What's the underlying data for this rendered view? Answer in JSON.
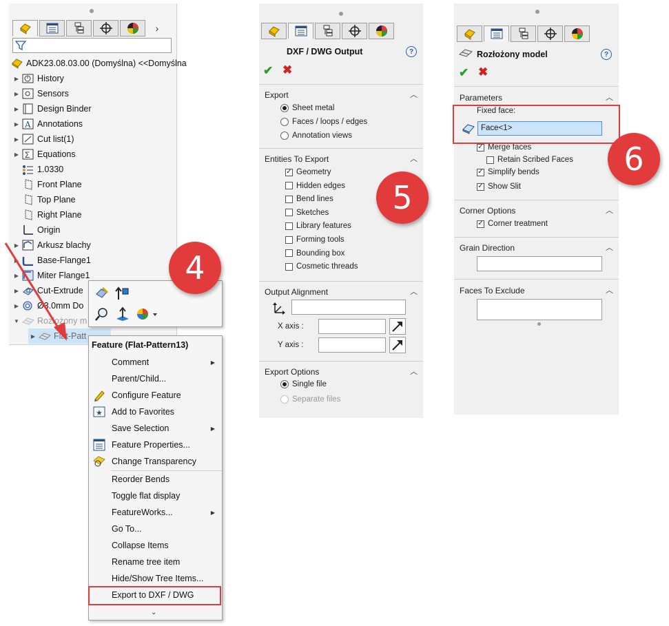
{
  "colors": {
    "accent_red": "#e23b3b",
    "ok_green": "#2c9a2c",
    "cancel_red": "#d42020",
    "selection_blue": "#cce4f7"
  },
  "tree": {
    "root": "ADK23.08.03.00 (Domyślna) <<Domyślna",
    "items": [
      {
        "label": "History",
        "icon": "history-icon"
      },
      {
        "label": "Sensors",
        "icon": "sensors-icon"
      },
      {
        "label": "Design Binder",
        "icon": "design-binder-icon"
      },
      {
        "label": "Annotations",
        "icon": "annotations-icon"
      },
      {
        "label": "Cut list(1)",
        "icon": "cut-list-icon"
      },
      {
        "label": "Equations",
        "icon": "equations-icon"
      },
      {
        "label": "1.0330",
        "icon": "material-icon"
      },
      {
        "label": "Front Plane",
        "icon": "plane-icon"
      },
      {
        "label": "Top Plane",
        "icon": "plane-icon"
      },
      {
        "label": "Right Plane",
        "icon": "plane-icon"
      },
      {
        "label": "Origin",
        "icon": "origin-icon"
      },
      {
        "label": "Arkusz blachy",
        "icon": "sheet-metal-icon"
      },
      {
        "label": "Base-Flange1",
        "icon": "base-flange-icon"
      },
      {
        "label": "Miter Flange1",
        "icon": "miter-flange-icon"
      },
      {
        "label": "Cut-Extrude",
        "icon": "cut-extrude-icon"
      },
      {
        "label": "Ø3.0mm Do",
        "icon": "hole-icon"
      },
      {
        "label": "Rozłożony m",
        "icon": "flat-pattern-icon"
      },
      {
        "label": "Flat-Patt",
        "icon": "flat-pattern-icon"
      }
    ]
  },
  "context_menu": {
    "header": "Feature (Flat-Pattern13)",
    "items": [
      {
        "label": "Comment",
        "submenu": true
      },
      {
        "label": "Parent/Child...",
        "submenu": false
      },
      {
        "label": "Configure Feature",
        "submenu": false
      },
      {
        "label": "Add to Favorites",
        "submenu": false
      },
      {
        "label": "Save Selection",
        "submenu": true
      },
      {
        "label": "Feature Properties...",
        "submenu": false
      },
      {
        "label": "Change Transparency",
        "submenu": false
      },
      {
        "label": "Reorder Bends",
        "submenu": false
      },
      {
        "label": "Toggle flat display",
        "submenu": false
      },
      {
        "label": "FeatureWorks...",
        "submenu": true
      },
      {
        "label": "Go To...",
        "submenu": false
      },
      {
        "label": "Collapse Items",
        "submenu": false
      },
      {
        "label": "Rename tree item",
        "submenu": false
      },
      {
        "label": "Hide/Show Tree Items...",
        "submenu": false
      },
      {
        "label": "Export to DXF / DWG",
        "submenu": false
      }
    ]
  },
  "dxf_panel": {
    "title": "DXF / DWG Output",
    "export": {
      "header": "Export",
      "options": [
        "Sheet metal",
        "Faces / loops / edges",
        "Annotation views"
      ],
      "selected": 0
    },
    "entities": {
      "header": "Entities To Export",
      "items": [
        {
          "label": "Geometry",
          "checked": true
        },
        {
          "label": "Hidden edges",
          "checked": false
        },
        {
          "label": "Bend lines",
          "checked": false
        },
        {
          "label": "Sketches",
          "checked": false
        },
        {
          "label": "Library features",
          "checked": false
        },
        {
          "label": "Forming tools",
          "checked": false
        },
        {
          "label": "Bounding box",
          "checked": false
        },
        {
          "label": "Cosmetic threads",
          "checked": false
        }
      ]
    },
    "alignment": {
      "header": "Output Alignment",
      "x_label": "X axis :",
      "y_label": "Y axis :"
    },
    "export_options": {
      "header": "Export Options",
      "single": "Single file",
      "separate": "Separate files"
    }
  },
  "flat_panel": {
    "title": "Rozłożony model",
    "parameters": {
      "header": "Parameters",
      "fixed_face_label": "Fixed face:",
      "fixed_face_value": "Face<1>",
      "merge_faces": "Merge faces",
      "retain_scribed": "Retain Scribed Faces",
      "simplify_bends": "Simplify bends",
      "show_slit": "Show Slit"
    },
    "corner": {
      "header": "Corner Options",
      "corner_treatment": "Corner treatment"
    },
    "grain": {
      "header": "Grain Direction"
    },
    "faces_exclude": {
      "header": "Faces To Exclude"
    }
  },
  "badges": {
    "four": "4",
    "five": "5",
    "six": "6"
  }
}
